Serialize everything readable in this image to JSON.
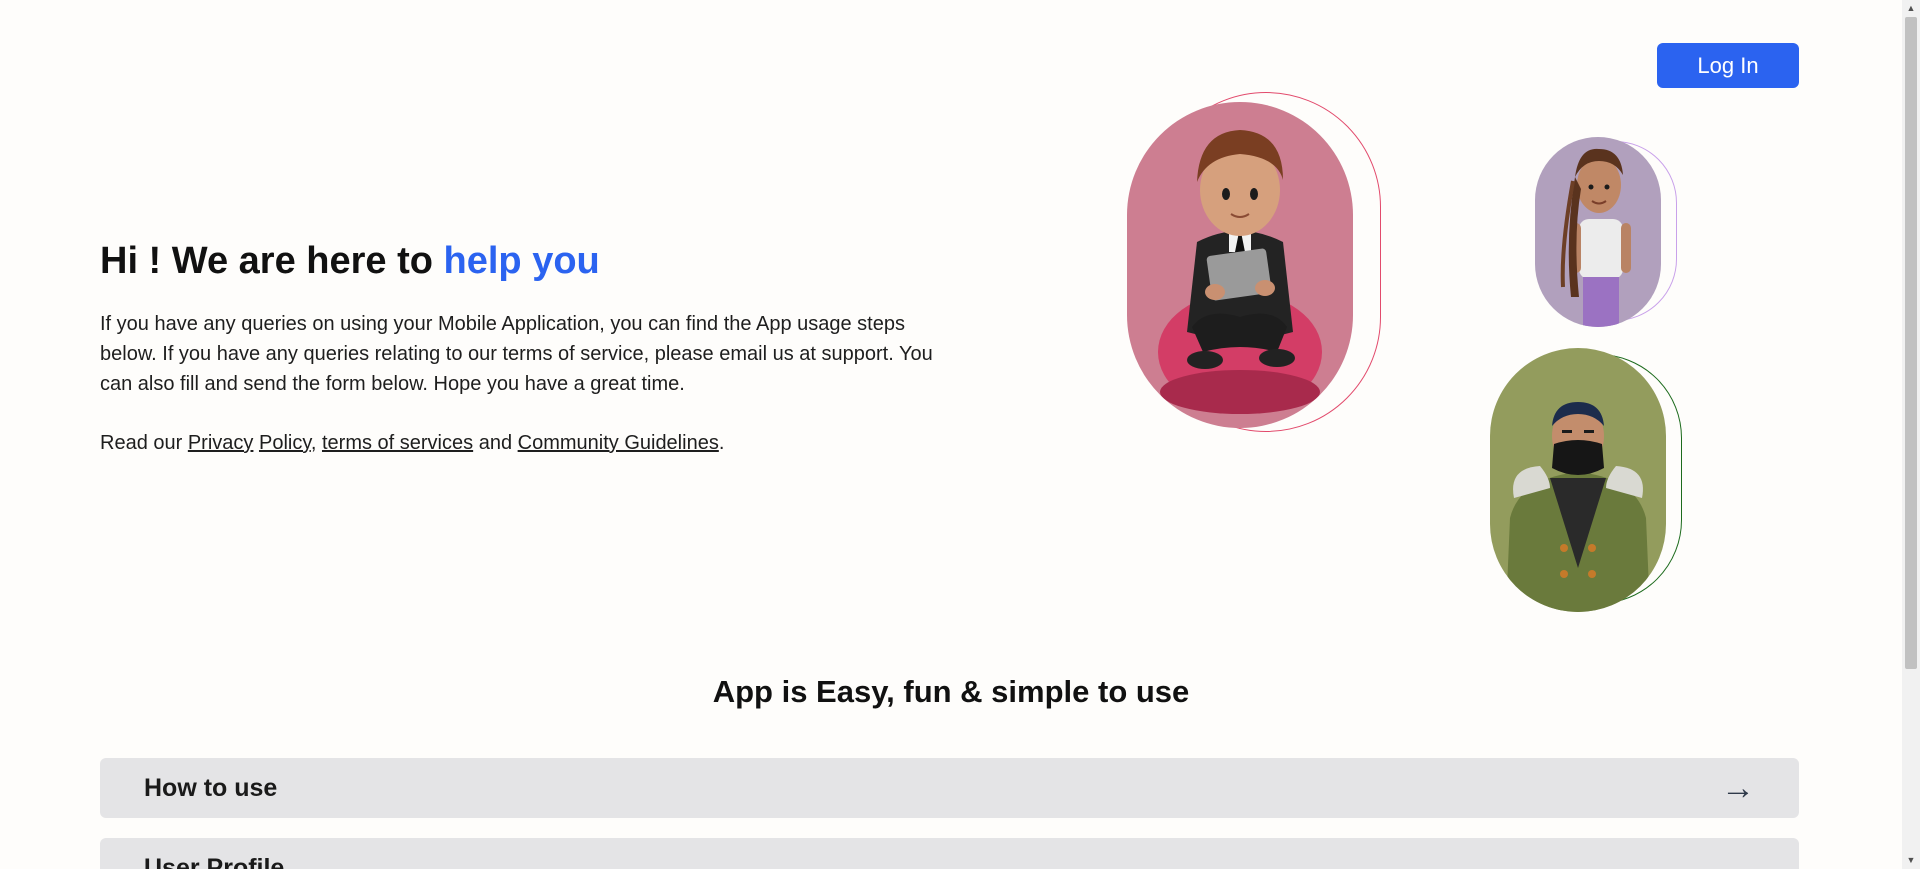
{
  "header": {
    "login_label": "Log In"
  },
  "hero": {
    "title_prefix": "Hi ! We are here to ",
    "title_accent": "help you",
    "paragraph": "If you have any queries on using your Mobile Application, you can find the App usage steps below. If you have any queries relating to our terms of service, please email us at support. You can also fill and send the form below. Hope you have a great time.",
    "links_prefix": "Read our ",
    "privacy_label": "Privacy",
    "policy_label": "Policy",
    "comma": ",",
    "terms_label": "terms of services",
    "and_text": " and ",
    "community_label": "Community Guidelines",
    "period": "."
  },
  "avatars": [
    {
      "name": "man-with-tablet",
      "bg": "#cd7e91",
      "outline": "#e24a6c"
    },
    {
      "name": "woman-with-dreadlocks",
      "bg": "#b1a0bd",
      "outline": "#c9a1ea"
    },
    {
      "name": "man-with-mask",
      "bg": "#939c5d",
      "outline": "#1d6b1d"
    }
  ],
  "section": {
    "title": "App is Easy, fun & simple to use",
    "items": [
      {
        "label": "How to use",
        "icon": "arrow-right-icon"
      },
      {
        "label": "User Profile",
        "icon": "arrow-right-icon"
      }
    ]
  },
  "colors": {
    "accent": "#2b63f0",
    "background": "#fefdfb",
    "accordion": "#e4e4e6"
  }
}
